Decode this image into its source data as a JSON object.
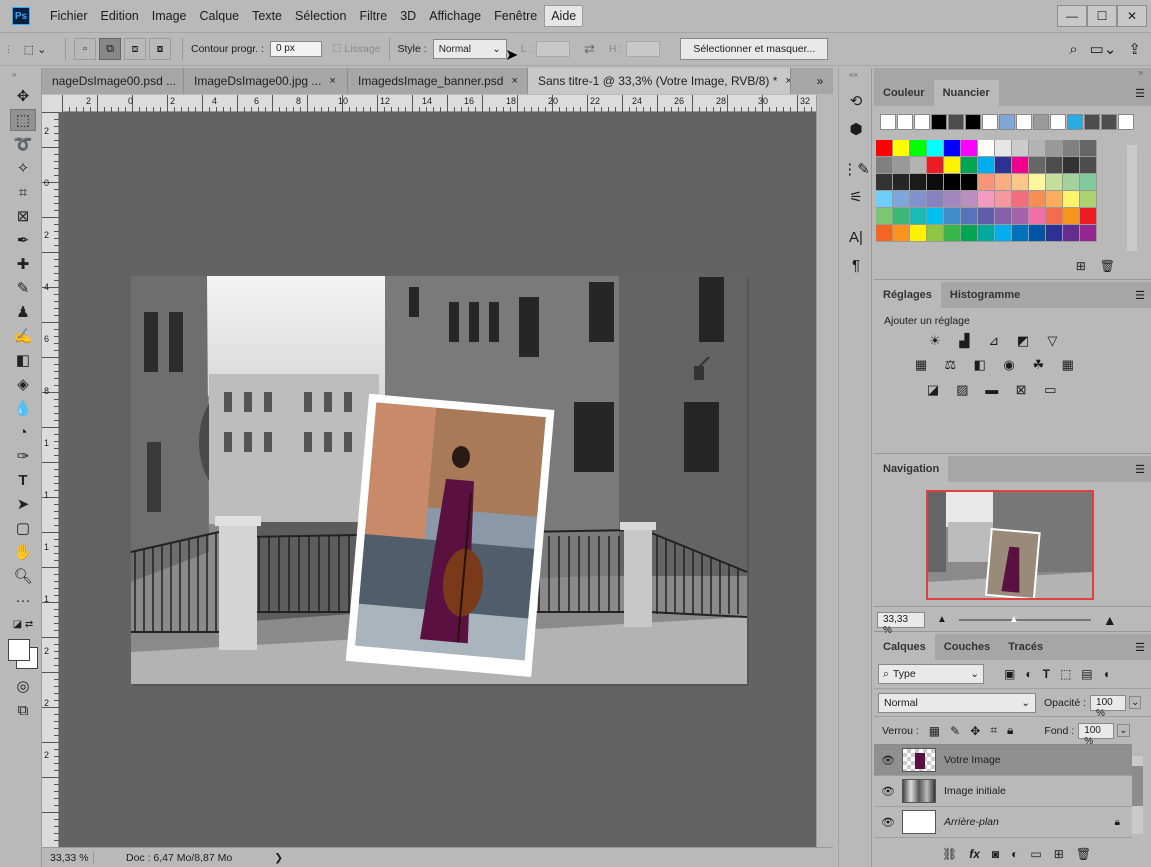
{
  "app": {
    "logo": "Ps"
  },
  "menu": [
    "Fichier",
    "Edition",
    "Image",
    "Calque",
    "Texte",
    "Sélection",
    "Filtre",
    "3D",
    "Affichage",
    "Fenêtre",
    "Aide"
  ],
  "options": {
    "contour_label": "Contour progr. :",
    "contour_value": "0 px",
    "lissage_label": "Lissage",
    "style_label": "Style :",
    "style_value": "Normal",
    "l_label": "L :",
    "h_label": "H :",
    "select_mask_button": "Sélectionner et masquer..."
  },
  "tabs": [
    {
      "label": "nageDsImage00.psd ...",
      "close": "×"
    },
    {
      "label": "ImageDsImage00.jpg ...",
      "close": "×"
    },
    {
      "label": "ImagedsImage_banner.psd",
      "close": "×"
    },
    {
      "label": "Sans titre-1 @ 33,3% (Votre Image, RVB/8) *",
      "close": "×"
    }
  ],
  "ruler_h": [
    "2",
    "0",
    "2",
    "4",
    "6",
    "8",
    "10",
    "12",
    "14",
    "16",
    "18",
    "20",
    "22",
    "24",
    "26",
    "28",
    "30",
    "32"
  ],
  "ruler_v": [
    "2",
    "0",
    "2",
    "4",
    "6",
    "8",
    "1",
    "1",
    "1",
    "1",
    "2",
    "2",
    "2"
  ],
  "status": {
    "zoom": "33,33 %",
    "doc": "Doc : 6,47 Mo/8,87 Mo",
    "arrow": "❯"
  },
  "panels": {
    "color": {
      "tabs": [
        "Couleur",
        "Nuancier"
      ],
      "active": 1
    },
    "adjustments": {
      "tabs": [
        "Réglages",
        "Histogramme"
      ],
      "active": 0,
      "add_label": "Ajouter un réglage"
    },
    "navigation": {
      "tabs": [
        "Navigation"
      ],
      "zoom": "33,33 %"
    },
    "layers": {
      "tabs": [
        "Calques",
        "Couches",
        "Tracés"
      ],
      "active": 0,
      "filter": "Type",
      "blend": "Normal",
      "opacity_label": "Opacité :",
      "opacity": "100 %",
      "lock_label": "Verrou :",
      "fill_label": "Fond :",
      "fill": "100 %",
      "items": [
        {
          "name": "Votre Image",
          "selected": true
        },
        {
          "name": "Image initiale",
          "selected": false
        },
        {
          "name": "Arrière-plan",
          "selected": false,
          "italic": true
        }
      ]
    }
  },
  "colors": {
    "row1": [
      "#ffffff",
      "#ffffff",
      "#ffffff",
      "#000000",
      "#4d4d4d",
      "#000000",
      "#ffffff",
      "#7ea6d6",
      "#ffffff",
      "#9a9a9a",
      "#ffffff",
      "#29abe2",
      "#4d4d4d",
      "#4d4d4d",
      "#ffffff"
    ],
    "grid": [
      [
        "#ff0000",
        "#ffff00",
        "#00ff00",
        "#00ffff",
        "#0000ff",
        "#ff00ff",
        "#ffffff",
        "#e6e6e6",
        "#cccccc",
        "#b3b3b3",
        "#999999",
        "#808080",
        "#666666"
      ],
      [
        "#808080",
        "#999999",
        "#b3b3b3",
        "#ed1c24",
        "#fff200",
        "#00a651",
        "#00aeef",
        "#2e3192",
        "#ec008c",
        "#666666",
        "#4d4d4d",
        "#333333",
        "#4d4d4d"
      ],
      [
        "#333333",
        "#262626",
        "#1a1a1a",
        "#0d0d0d",
        "#000000",
        "#000000",
        "#f7977a",
        "#f9ad81",
        "#fdc68a",
        "#fff79a",
        "#c4df9b",
        "#a3d39c",
        "#82ca9d"
      ],
      [
        "#6dcff6",
        "#7da7d9",
        "#8393ca",
        "#8781bd",
        "#a187be",
        "#bc8dbf",
        "#f49ac2",
        "#f6989d",
        "#f26d7d",
        "#f68e55",
        "#fbaf5d",
        "#fff467",
        "#acd372"
      ],
      [
        "#7cc576",
        "#3bb878",
        "#1abbb4",
        "#00bff3",
        "#438ccb",
        "#5574b9",
        "#605ca8",
        "#855fa8",
        "#a763a8",
        "#f06eaa",
        "#f26c4f",
        "#f7941d",
        "#ed1c24"
      ],
      [
        "#f26522",
        "#f7941d",
        "#fff200",
        "#8dc63f",
        "#39b54a",
        "#00a651",
        "#00a99d",
        "#00aeef",
        "#0072bc",
        "#0054a6",
        "#2e3192",
        "#662d91",
        "#92278f"
      ]
    ]
  }
}
